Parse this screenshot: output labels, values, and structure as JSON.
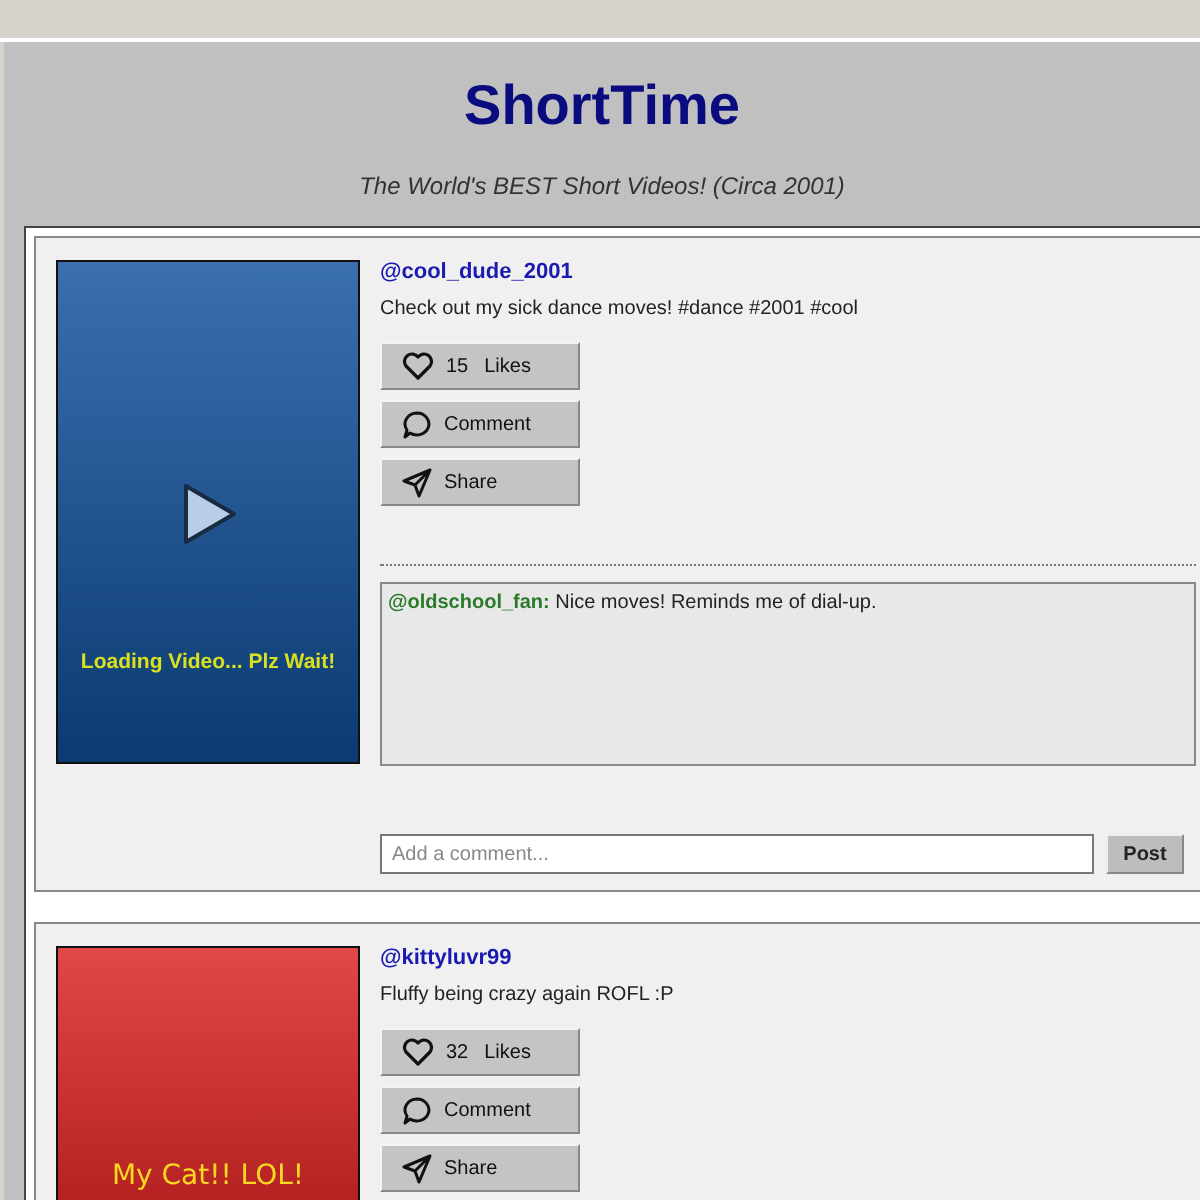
{
  "site": {
    "title": "ShortTime",
    "tagline": "The World's BEST Short Videos! (Circa 2001)"
  },
  "posts": [
    {
      "video": {
        "kind": "loading",
        "text": "Loading Video... Plz Wait!"
      },
      "user": "@cool_dude_2001",
      "caption": "Check out my sick dance moves! #dance #2001 #cool",
      "likes": "15",
      "likes_label": "Likes",
      "comment_label": "Comment",
      "share_label": "Share",
      "comments": [
        {
          "user": "@oldschool_fan:",
          "text": "Nice moves! Reminds me of dial-up."
        }
      ],
      "comment_placeholder": "Add a comment...",
      "post_label": "Post"
    },
    {
      "video": {
        "kind": "caption",
        "text": "My Cat!! LOL!"
      },
      "user": "@kittyluvr99",
      "caption": "Fluffy being crazy again ROFL :P",
      "likes": "32",
      "likes_label": "Likes",
      "comment_label": "Comment",
      "share_label": "Share"
    }
  ]
}
